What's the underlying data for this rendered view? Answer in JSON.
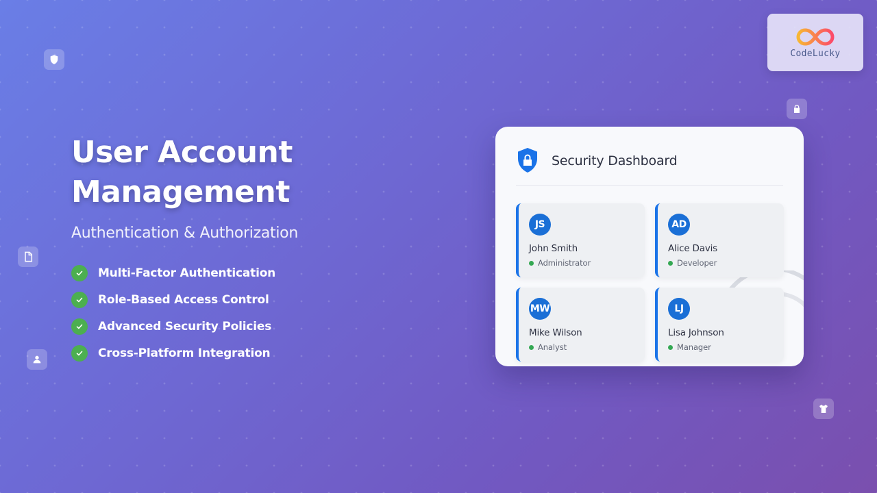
{
  "brand": {
    "name": "CodeLucky"
  },
  "hero": {
    "title_line1": "User Account",
    "title_line2": "Management",
    "subtitle": "Authentication & Authorization",
    "features": [
      "Multi-Factor Authentication",
      "Role-Based Access Control",
      "Advanced Security Policies",
      "Cross-Platform Integration"
    ]
  },
  "dashboard": {
    "title": "Security Dashboard",
    "users": [
      {
        "initials": "JS",
        "name": "John Smith",
        "role": "Administrator"
      },
      {
        "initials": "AD",
        "name": "Alice Davis",
        "role": "Developer"
      },
      {
        "initials": "MW",
        "name": "Mike Wilson",
        "role": "Analyst"
      },
      {
        "initials": "LJ",
        "name": "Lisa Johnson",
        "role": "Manager"
      }
    ]
  },
  "decor_icons": [
    "shield-icon",
    "document-icon",
    "user-icon",
    "lock-icon",
    "tshirt-icon"
  ],
  "colors": {
    "bg_start": "#6a7ee6",
    "bg_end": "#7a4fae",
    "accent_blue": "#1a73e8",
    "check_green": "#4caf50",
    "status_green": "#34a853"
  }
}
